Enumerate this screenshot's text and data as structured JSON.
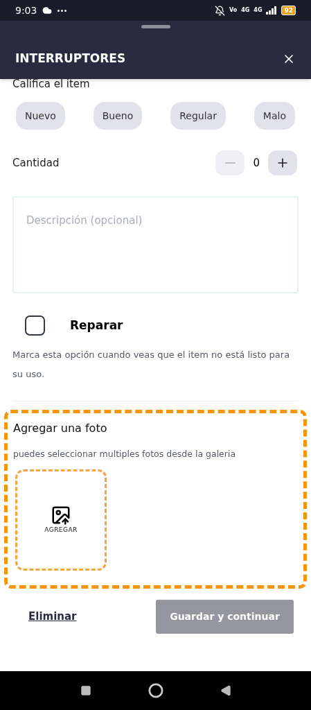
{
  "status_bar": {
    "time": "9:03",
    "network_labels": [
      "Vo",
      "4G",
      "4G"
    ],
    "battery": "92"
  },
  "sheet": {
    "title": "INTERRUPTORES"
  },
  "rating": {
    "label": "Califica el item",
    "options": [
      {
        "label": "Nuevo",
        "selected": false
      },
      {
        "label": "Bueno",
        "selected": false
      },
      {
        "label": "Regular",
        "selected": false
      },
      {
        "label": "Malo",
        "selected": false
      }
    ]
  },
  "quantity": {
    "label": "Cantidad",
    "value": "0",
    "minus_disabled": true
  },
  "description": {
    "placeholder": "Descripción (opcional)"
  },
  "repair": {
    "label": "Reparar",
    "checked": false,
    "hint": "Marca esta opción cuando veas que el item no está listo para su uso."
  },
  "photos": {
    "title": "Agregar una foto",
    "hint": "puedes seleccionar multiples fotos desde la galeria",
    "add_label": "AGREGAR"
  },
  "actions": {
    "delete": "Eliminar",
    "save": "Guardar y continuar",
    "save_disabled": true
  }
}
